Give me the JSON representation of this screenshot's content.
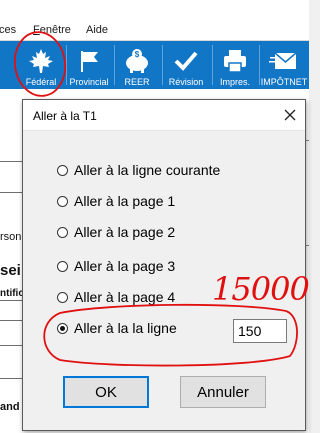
{
  "menubar": {
    "items": [
      {
        "label": "ces"
      },
      {
        "label_first": "F",
        "label_rest": "enêtre"
      },
      {
        "label": "Aide"
      }
    ]
  },
  "toolbar": {
    "buttons": [
      {
        "label": "Fédéral",
        "icon": "maple-leaf-icon"
      },
      {
        "label": "Provincial",
        "icon": "flag-icon"
      },
      {
        "label": "REER",
        "icon": "piggy-bank-icon"
      },
      {
        "label": "Révision",
        "icon": "check-icon"
      },
      {
        "label": "Impres.",
        "icon": "printer-icon"
      },
      {
        "label": "IMPÔTNET",
        "icon": "envelope-icon"
      }
    ]
  },
  "background": {
    "fragments": [
      "rson",
      "sei",
      "ntific",
      "and"
    ]
  },
  "dialog": {
    "title": "Aller à la T1",
    "options": [
      {
        "label": "Aller à la ligne courante",
        "checked": false
      },
      {
        "label": "Aller à la page 1",
        "checked": false
      },
      {
        "label": "Aller à la page 2",
        "checked": false
      },
      {
        "label": "Aller à la page 3",
        "checked": false
      },
      {
        "label": "Aller à la page 4",
        "checked": false
      },
      {
        "label": "Aller à la la ligne",
        "checked": true
      }
    ],
    "line_value": "150",
    "ok_label": "OK",
    "cancel_label": "Annuler"
  },
  "annotation": {
    "handwritten_text": "15000",
    "color": "#e01010"
  },
  "colors": {
    "toolbar_bg": "#1276c7",
    "accent": "#0078d7"
  }
}
